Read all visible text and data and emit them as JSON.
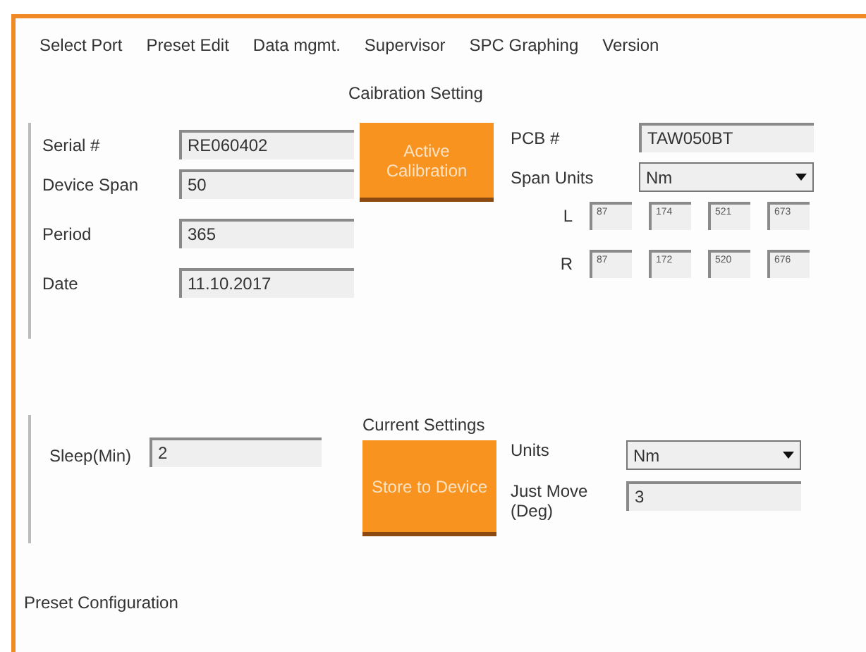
{
  "menu": [
    "Select Port",
    "Preset Edit",
    "Data mgmt.",
    "Supervisor",
    "SPC Graphing",
    "Version"
  ],
  "calibration": {
    "title": "Caibration Setting",
    "left_fields": [
      {
        "label": "Serial #",
        "value": "RE060402"
      },
      {
        "label": "Device Span",
        "value": "50"
      },
      {
        "label": "Period",
        "value": "365"
      },
      {
        "label": "Date",
        "value": "11.10.2017"
      }
    ],
    "button": "Active Calibration",
    "right_fields": [
      {
        "label": "PCB #",
        "value": "TAW050BT",
        "kind": "text"
      },
      {
        "label": "Span Units",
        "value": "Nm",
        "kind": "dropdown"
      }
    ],
    "channels": [
      {
        "label": "L",
        "values": [
          "87",
          "174",
          "521",
          "673"
        ]
      },
      {
        "label": "R",
        "values": [
          "87",
          "172",
          "520",
          "676"
        ]
      }
    ]
  },
  "current": {
    "title": "Current Settings",
    "sleep": {
      "label": "Sleep(Min)",
      "value": "2"
    },
    "button": "Store to Device",
    "right_fields": [
      {
        "label": "Units",
        "value": "Nm",
        "kind": "dropdown"
      },
      {
        "label": "Just Move (Deg)",
        "value": "3",
        "kind": "text"
      }
    ]
  },
  "preset_title": "Preset Configuration"
}
